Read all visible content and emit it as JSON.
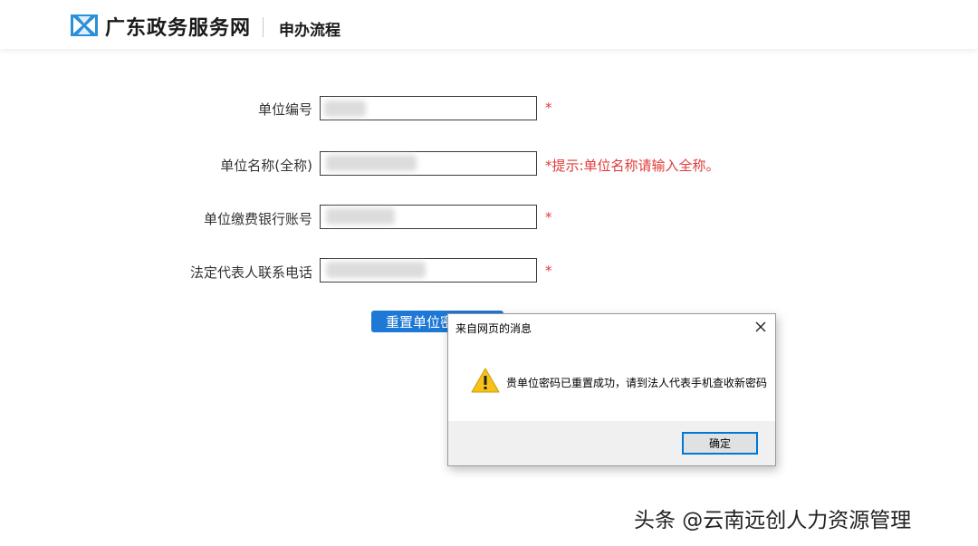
{
  "header": {
    "site_title": "广东政务服务网",
    "section": "申办流程",
    "logo_color": "#2b8fd9"
  },
  "form": {
    "fields": [
      {
        "label": "单位编号",
        "value": "",
        "required_mark": "*"
      },
      {
        "label": "单位名称(全称)",
        "value": "",
        "hint": "*提示:单位名称请输入全称。"
      },
      {
        "label": "单位缴费银行账号",
        "value": "",
        "required_mark": "*"
      },
      {
        "label": "法定代表人联系电话",
        "value": "",
        "required_mark": "*"
      }
    ],
    "reset_button_label": "重置单位密码",
    "accent_color": "#1e78d6",
    "required_color": "#e23a3a"
  },
  "dialog": {
    "title": "来自网页的消息",
    "message": "贵单位密码已重置成功，请到法人代表手机查收新密码",
    "ok_label": "确定",
    "icon": "warning-icon",
    "close_icon": "close-icon"
  },
  "watermark": "头条 @云南远创人力资源管理"
}
